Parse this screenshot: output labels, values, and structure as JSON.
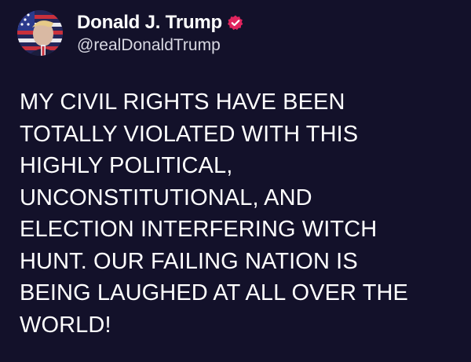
{
  "post": {
    "author": {
      "display_name": "Donald J. Trump",
      "handle": "@realDonaldTrump",
      "verified_icon": "verified-badge-icon",
      "verified_color": "#e0245e",
      "avatar_icon": "avatar-flag-portrait"
    },
    "text": "MY CIVIL RIGHTS HAVE BEEN\nTOTALLY VIOLATED WITH THIS\nHIGHLY POLITICAL,\nUNCONSTITUTIONAL, AND\nELECTION INTERFERING WITCH\nHUNT. OUR FAILING NATION IS\nBEING LAUGHED AT ALL OVER THE\nWORLD!"
  },
  "colors": {
    "background": "#13112a",
    "text": "#ffffff",
    "handle": "#d9d9e3"
  }
}
